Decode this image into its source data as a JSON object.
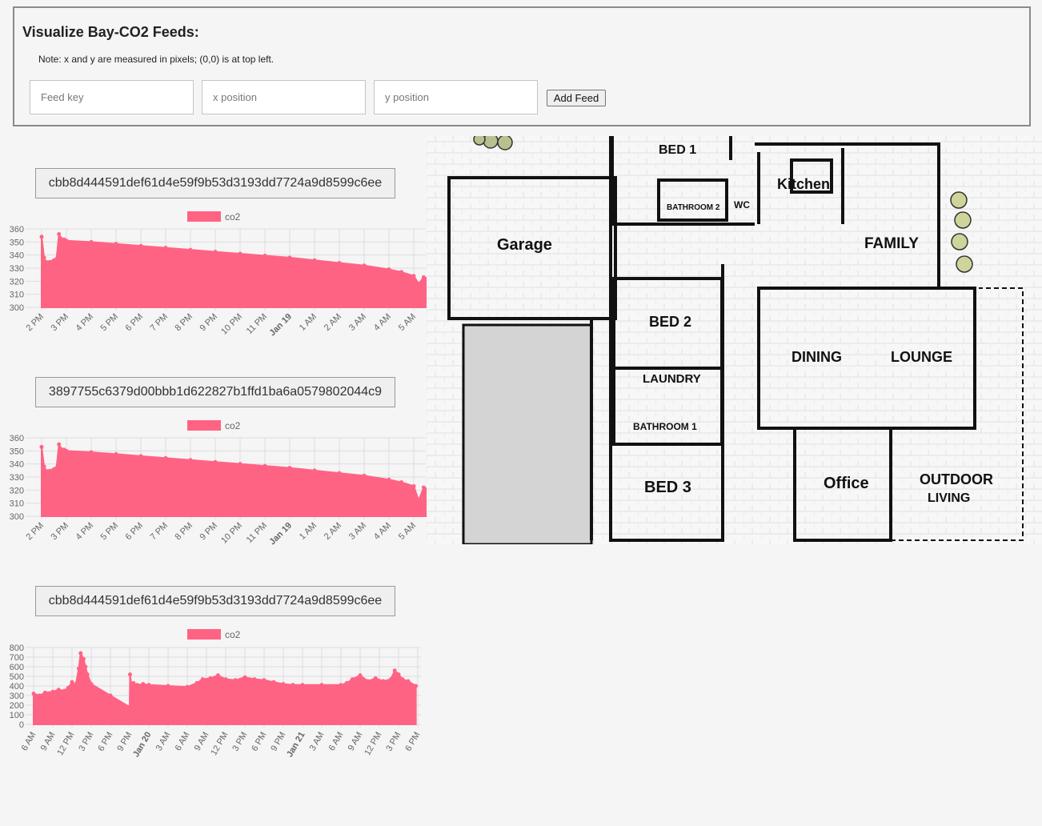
{
  "header": {
    "title": "Visualize Bay-CO2 Feeds:",
    "note": "Note: x and y are measured in pixels; (0,0) is at top left.",
    "inputs": {
      "feed_key_placeholder": "Feed key",
      "x_placeholder": "x position",
      "y_placeholder": "y position"
    },
    "add_button": "Add Feed"
  },
  "colors": {
    "series": "#ff6384",
    "grid": "#dddddd",
    "axis_text": "#666666"
  },
  "feeds": [
    {
      "key": "cbb8d444591def61d4e59f9b53d3193dd7724a9d8599c6ee",
      "legend": "co2"
    },
    {
      "key": "3897755c6379d00bbb1d622827b1ffd1ba6a0579802044c9",
      "legend": "co2"
    },
    {
      "key": "cbb8d444591def61d4e59f9b53d3193dd7724a9d8599c6ee",
      "legend": "co2"
    }
  ],
  "chart_data": [
    {
      "type": "area",
      "series": [
        {
          "name": "co2",
          "color": "#ff6384"
        }
      ],
      "ylim": [
        300,
        360
      ],
      "yticks": [
        300,
        310,
        320,
        330,
        340,
        350,
        360
      ],
      "xticks": [
        "2 PM",
        "3 PM",
        "4 PM",
        "5 PM",
        "6 PM",
        "7 PM",
        "8 PM",
        "9 PM",
        "10 PM",
        "11 PM",
        "Jan 19",
        "1 AM",
        "2 AM",
        "3 AM",
        "4 AM",
        "5 AM"
      ],
      "bold_ticks": [
        "Jan 19"
      ],
      "x": [
        0,
        0.1,
        0.15,
        0.5,
        0.6,
        0.7,
        0.75,
        0.9,
        1,
        2,
        3,
        4,
        5,
        6,
        7,
        8,
        9,
        10,
        11,
        12,
        13,
        14,
        14.5,
        15,
        15.2,
        15.4,
        15.6
      ],
      "values": [
        354,
        338,
        335,
        336,
        337,
        356,
        353,
        352,
        351,
        350,
        348.5,
        347,
        345.5,
        344,
        342.5,
        341,
        339.5,
        338,
        336,
        334,
        332,
        329,
        327,
        324,
        318,
        323,
        322
      ]
    },
    {
      "type": "area",
      "series": [
        {
          "name": "co2",
          "color": "#ff6384"
        }
      ],
      "ylim": [
        300,
        360
      ],
      "yticks": [
        300,
        310,
        320,
        330,
        340,
        350,
        360
      ],
      "xticks": [
        "2 PM",
        "3 PM",
        "4 PM",
        "5 PM",
        "6 PM",
        "7 PM",
        "8 PM",
        "9 PM",
        "10 PM",
        "11 PM",
        "Jan 19",
        "1 AM",
        "2 AM",
        "3 AM",
        "4 AM",
        "5 AM"
      ],
      "bold_ticks": [
        "Jan 19"
      ],
      "x": [
        0,
        0.1,
        0.15,
        0.5,
        0.6,
        0.7,
        0.75,
        0.9,
        1,
        2,
        3,
        4,
        5,
        6,
        7,
        8,
        9,
        10,
        11,
        12,
        13,
        14,
        14.5,
        15,
        15.2,
        15.4,
        15.6
      ],
      "values": [
        353,
        338,
        335,
        336,
        337,
        355,
        352,
        351,
        350,
        349,
        347.5,
        346,
        344.5,
        343,
        341.5,
        340,
        338.5,
        337,
        335,
        333,
        331,
        328,
        326,
        323,
        312,
        322,
        321
      ]
    },
    {
      "type": "area",
      "series": [
        {
          "name": "co2",
          "color": "#ff6384"
        }
      ],
      "ylim": [
        0,
        800
      ],
      "yticks": [
        0,
        100,
        200,
        300,
        400,
        500,
        600,
        700,
        800
      ],
      "xticks": [
        "6 AM",
        "9 AM",
        "12 PM",
        "3 PM",
        "6 PM",
        "9 PM",
        "Jan 20",
        "3 AM",
        "6 AM",
        "9 AM",
        "12 PM",
        "3 PM",
        "6 PM",
        "9 PM",
        "Jan 21",
        "3 AM",
        "6 AM",
        "9 AM",
        "12 PM",
        "3 PM",
        "6 PM"
      ],
      "bold_ticks": [
        "Jan 20",
        "Jan 21"
      ],
      "x": [
        0,
        0.3,
        0.6,
        1,
        1.3,
        1.6,
        1.8,
        2,
        2.1,
        2.2,
        2.35,
        2.45,
        2.6,
        2.7,
        2.8,
        3,
        4,
        5,
        5.02,
        5.1,
        5.2,
        5.4,
        5.7,
        6,
        7,
        8,
        8.5,
        8.8,
        9.2,
        9.6,
        10,
        10.5,
        11,
        11.5,
        12,
        12.5,
        13,
        13.5,
        14,
        15,
        16,
        16.3,
        16.6,
        17,
        17.4,
        17.8,
        18.2,
        18.6,
        18.8,
        19,
        19.2,
        19.5,
        19.9
      ],
      "values": [
        320,
        300,
        330,
        340,
        360,
        350,
        380,
        440,
        400,
        420,
        580,
        740,
        680,
        600,
        520,
        420,
        300,
        180,
        520,
        400,
        430,
        410,
        420,
        410,
        400,
        390,
        430,
        470,
        480,
        510,
        470,
        460,
        490,
        470,
        460,
        440,
        420,
        410,
        410,
        410,
        410,
        430,
        470,
        510,
        450,
        480,
        450,
        470,
        560,
        520,
        470,
        450,
        400
      ]
    }
  ],
  "floorplan": {
    "rooms": {
      "bed1": "BED 1",
      "bathroom2": "BATHROOM 2",
      "wc": "WC",
      "kitchen": "Kitchen",
      "garage": "Garage",
      "family": "FAMILY",
      "bed2": "BED 2",
      "dining": "DINING",
      "lounge": "LOUNGE",
      "laundry": "LAUNDRY",
      "bathroom1": "BATHROOM 1",
      "bed3": "BED 3",
      "office": "Office",
      "outdoor": "OUTDOOR",
      "living": "LIVING"
    }
  }
}
